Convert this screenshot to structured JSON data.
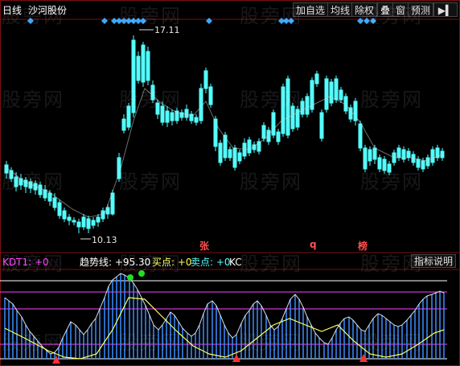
{
  "header": {
    "period": "日线",
    "stock_name": "沙河股份",
    "buttons": [
      "加自选",
      "均线",
      "除权",
      "叠",
      "窗",
      "预测"
    ]
  },
  "watermark": "股旁网",
  "price_labels": {
    "high": "17.11",
    "low": "10.13"
  },
  "signal_marks": {
    "zhang": "张",
    "q": "q",
    "bang": "榜"
  },
  "indicator": {
    "name": "KDT1:",
    "name_value": "+0",
    "trend_label": "趋势线:",
    "trend_value": "+95.30",
    "buy_label": "买点:",
    "buy_value": "+0",
    "sell_label": "卖点:",
    "sell_value": "+0",
    "extra": "KC",
    "help_button": "指标说明"
  },
  "colors": {
    "up": "#ff4040",
    "down": "#54ffff",
    "diamond": "#3aa8ff",
    "ma": "#c8c8c8",
    "hist": "#3a8dff",
    "trend": "#ffff60",
    "line_white": "#ffffff",
    "line_magenta": "#ff40ff",
    "signal_green": "#20e020"
  }
}
